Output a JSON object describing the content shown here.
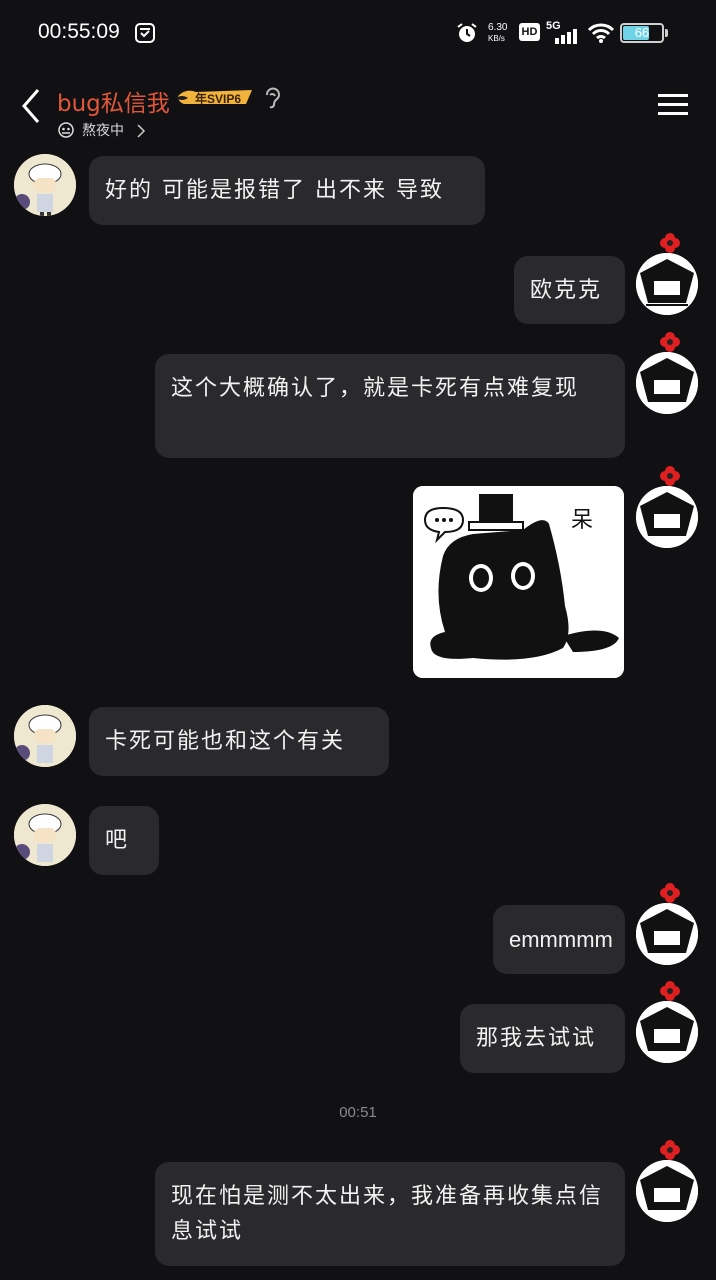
{
  "status": {
    "time": "00:55:09",
    "net_speed_value": "6.30",
    "net_speed_unit": "KB/s",
    "hd": "HD",
    "signal": "5G",
    "battery": "66"
  },
  "header": {
    "title": "bug私信我",
    "vip_badge": "年SVIP6",
    "subtitle": "熬夜中"
  },
  "messages": [
    {
      "side": "left",
      "text": "好的 可能是报错了 出不来 导致"
    },
    {
      "side": "right",
      "text": "欧克克"
    },
    {
      "side": "right",
      "text": "这个大概确认了，就是卡死有点难复现"
    },
    {
      "side": "right",
      "type": "sticker",
      "caption": "呆"
    },
    {
      "side": "left",
      "text": "卡死可能也和这个有关"
    },
    {
      "side": "left",
      "text": "吧"
    },
    {
      "side": "right",
      "text": "emmmmm"
    },
    {
      "side": "right",
      "text": "那我去试试"
    },
    {
      "side": "right",
      "text": "现在怕是测不太出来，我准备再收集点信息试试"
    }
  ],
  "timestamp": "00:51",
  "colors": {
    "background": "#111114",
    "bubble": "#2a2a2d",
    "title": "#e0573a",
    "vip_gold": "#f2b33d"
  }
}
